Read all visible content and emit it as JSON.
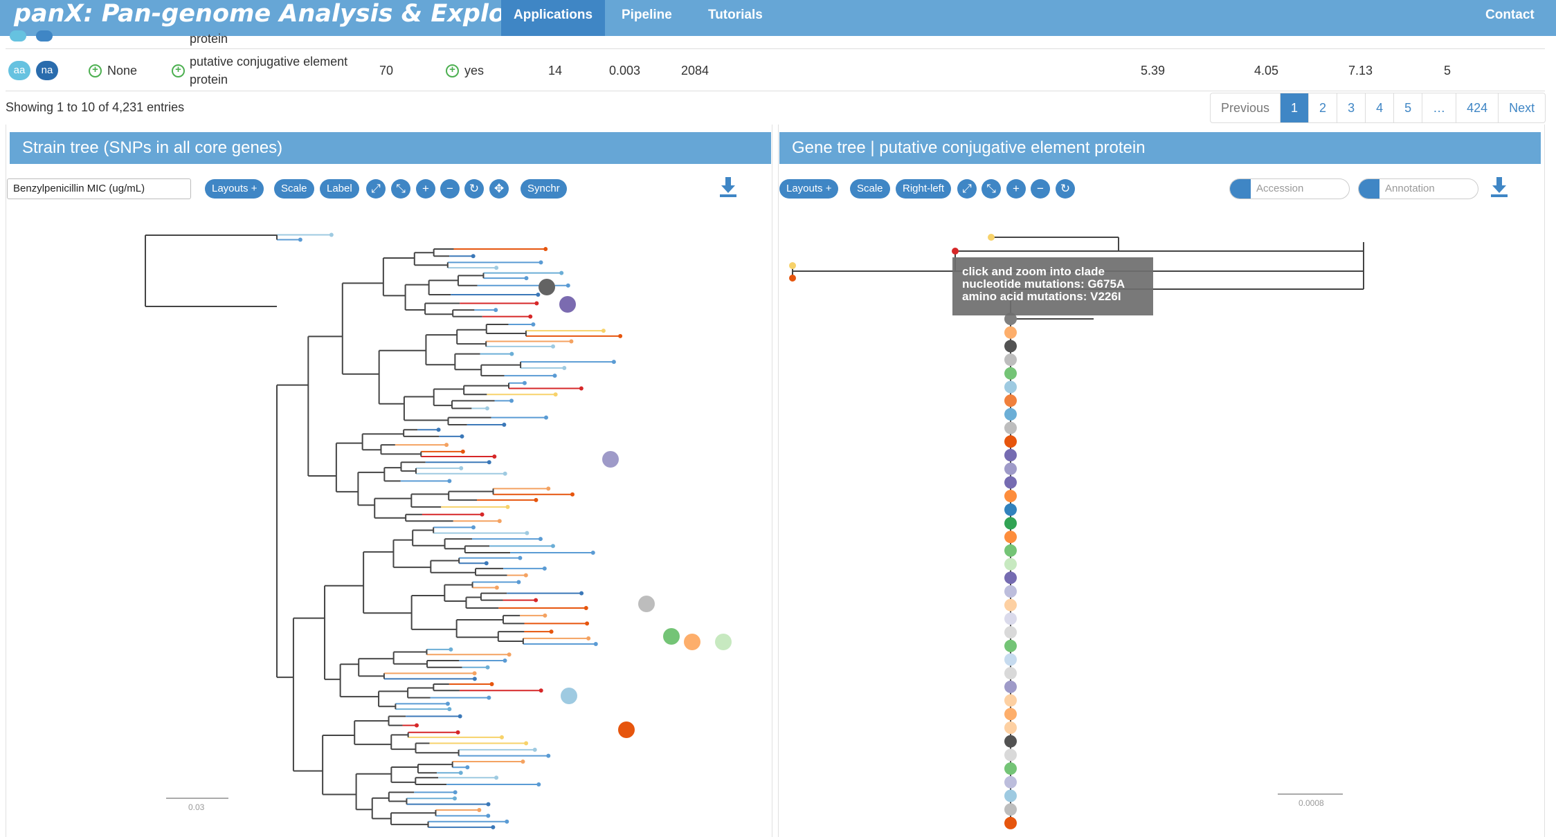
{
  "navbar": {
    "brand": "panX: Pan-genome Analysis & Exploration",
    "items": [
      "Applications",
      "Pipeline",
      "Tutorials"
    ],
    "contact": "Contact"
  },
  "table": {
    "partial_row_text": "protein",
    "row": {
      "aa": "aa",
      "na": "na",
      "gene_name": "None",
      "annotation": "putative conjugative element protein",
      "count": "70",
      "duplicated": "yes",
      "events": "14",
      "diversity": "0.003",
      "length": "2084",
      "col_a": "5.39",
      "col_b": "4.05",
      "col_c": "7.13",
      "col_d": "5"
    },
    "info": "Showing 1 to 10 of 4,231 entries",
    "pagination": [
      "Previous",
      "1",
      "2",
      "3",
      "4",
      "5",
      "…",
      "424",
      "Next"
    ]
  },
  "strain_panel": {
    "title": "Strain tree (SNPs in all core genes)",
    "metadata_select": "Benzylpenicillin MIC (ug/mL)",
    "layouts": "Layouts",
    "scale": "Scale",
    "label": "Label",
    "synchr": "Synchr",
    "scale_bar": "0.03"
  },
  "gene_panel": {
    "title": "Gene tree | putative conjugative element protein",
    "layouts": "Layouts",
    "scale": "Scale",
    "right_left": "Right-left",
    "accession_placeholder": "Accession",
    "annotation_placeholder": "Annotation",
    "scale_bar": "0.0008"
  },
  "tooltip": {
    "line1": "click and zoom into clade",
    "line2": "nucleotide mutations: G675A",
    "line3": "amino acid mutations: V226I"
  },
  "colors": {
    "nav": "#66a6d6",
    "accent": "#3f86c5",
    "branch_blue": "#5a9bd4",
    "branch_red": "#d62728",
    "branch_orange": "#f4a261",
    "branch_yellow": "#f7d26a"
  },
  "icons": [
    "expand-icon",
    "compress-icon",
    "zoom-in-icon",
    "zoom-out-icon",
    "reset-icon",
    "move-icon",
    "download-icon",
    "search-icon"
  ]
}
